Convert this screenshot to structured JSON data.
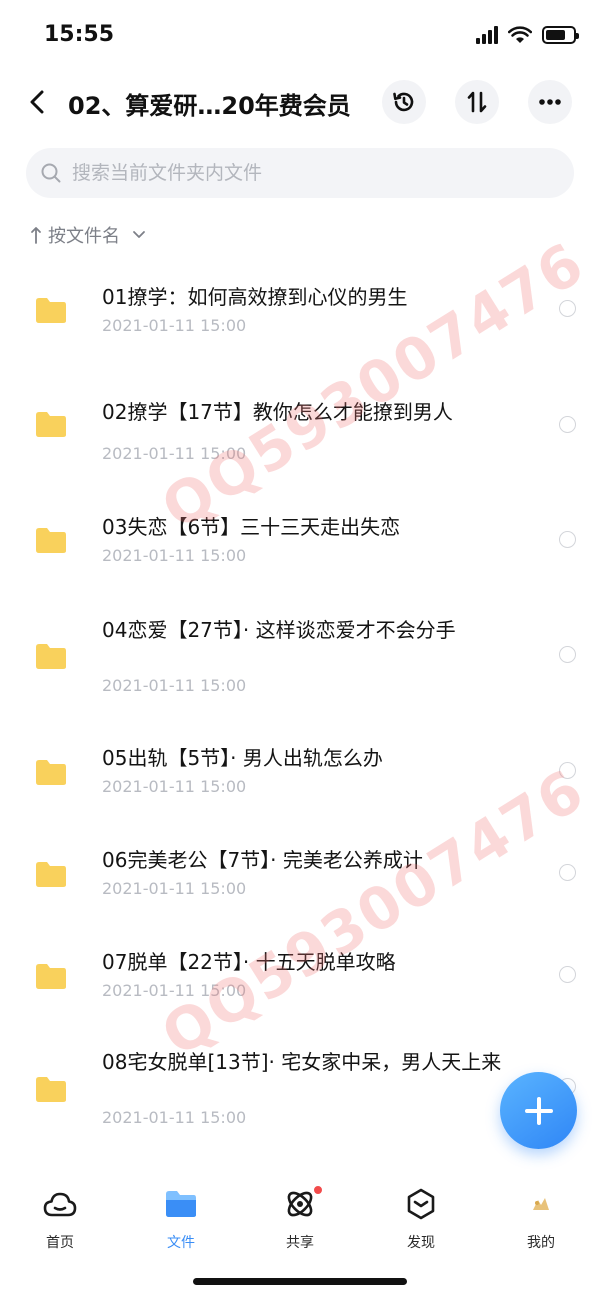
{
  "status_bar": {
    "time": "15:55",
    "battery_level": 0.72
  },
  "header": {
    "back_icon": "chevron-left-icon",
    "title": "02、算爱研…20年费会员",
    "buttons": [
      "history-icon",
      "transfer-icon",
      "more-icon"
    ]
  },
  "search": {
    "placeholder": "搜索当前文件夹内文件",
    "value": ""
  },
  "sort": {
    "label": "按文件名"
  },
  "files": [
    {
      "name": "01撩学：如何高效撩到心仪的男生",
      "date": "2021-01-11 15:00"
    },
    {
      "name": "02撩学【17节】教你怎么才能撩到男人",
      "date": "2021-01-11 15:00"
    },
    {
      "name": "03失恋【6节】三十三天走出失恋",
      "date": "2021-01-11 15:00"
    },
    {
      "name": "04恋爱【27节】· 这样谈恋爱才不会分手",
      "date": "2021-01-11 15:00"
    },
    {
      "name": "05出轨【5节】· 男人出轨怎么办",
      "date": "2021-01-11 15:00"
    },
    {
      "name": "06完美老公【7节】· 完美老公养成计",
      "date": "2021-01-11 15:00"
    },
    {
      "name": "07脱单【22节】· 十五天脱单攻略",
      "date": "2021-01-11 15:00"
    },
    {
      "name": "08宅女脱单[13节]· 宅女家中呆，男人天上来",
      "date": "2021-01-11 15:00"
    }
  ],
  "watermark": {
    "text": "QQ593007476"
  },
  "fab": {
    "icon": "plus-icon"
  },
  "tabs": [
    {
      "label": "首页",
      "icon": "cloud-icon"
    },
    {
      "label": "文件",
      "icon": "folder-icon",
      "active": true
    },
    {
      "label": "共享",
      "icon": "orbit-icon",
      "badge": true
    },
    {
      "label": "发现",
      "icon": "compass-icon"
    },
    {
      "label": "我的",
      "icon": "avatar-icon"
    }
  ],
  "colors": {
    "accent": "#3a8ef6",
    "folder": "#f9d15c",
    "badge": "#f24b4b"
  }
}
